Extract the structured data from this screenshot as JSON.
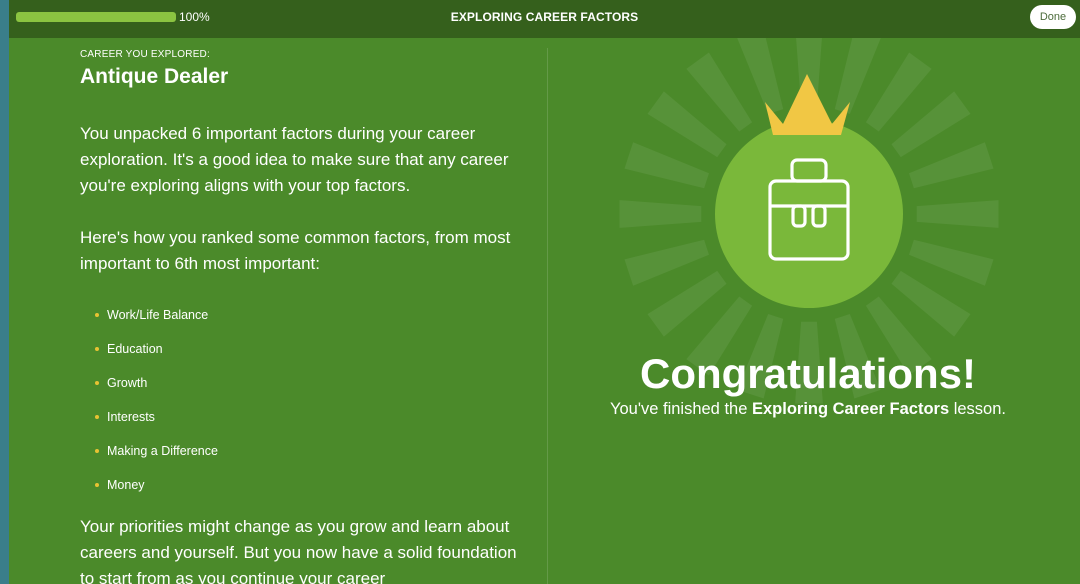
{
  "header": {
    "progress_percent": 100,
    "progress_label": "100%",
    "lesson_title": "EXPLORING CAREER FACTORS",
    "done_label": "Done"
  },
  "left": {
    "eyebrow": "CAREER YOU EXPLORED:",
    "career_name": "Antique Dealer",
    "paragraph1": "You unpacked 6 important factors during your career exploration. It's a good idea to make sure that any career you're exploring aligns with your top factors.",
    "paragraph2": "Here's how you ranked some common factors, from most important to 6th most important:",
    "factors": [
      "Work/Life Balance",
      "Education",
      "Growth",
      "Interests",
      "Making a Difference",
      "Money"
    ],
    "paragraph3": "Your priorities might change as you grow and learn about careers and yourself. But you now have a solid foundation to start from as you continue your career"
  },
  "right": {
    "badge_icon": "briefcase-icon",
    "crown_icon": "crown-icon",
    "congrats_title": "Congratulations!",
    "sub_prefix": "You've finished the ",
    "sub_lesson": "Exploring Career Factors",
    "sub_suffix": " lesson."
  },
  "colors": {
    "background": "#4b8a2a",
    "topbar": "#35601c",
    "progress_fill": "#8bc441",
    "badge_circle": "#7ab83a",
    "crown": "#f1c744",
    "bullet": "#e8c233"
  }
}
